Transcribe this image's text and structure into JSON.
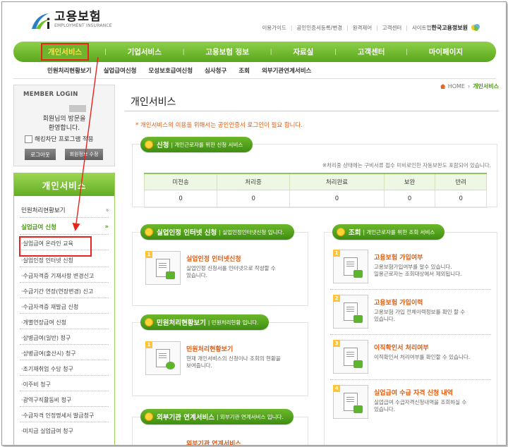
{
  "header": {
    "logo_ko": "고용보험",
    "logo_en": "EMPLOYMENT INSURANCE",
    "util_links": [
      "이용가이드",
      "공인인증서등록/변경",
      "원격제어",
      "고객센터",
      "사이트맵"
    ],
    "agency": "한국고용정보원"
  },
  "gnb": [
    "개인서비스",
    "기업서비스",
    "고용보험 정보",
    "자료실",
    "고객센터",
    "마이페이지"
  ],
  "subnav": [
    "민원처리현황보기",
    "실업급여신청",
    "모성보호급여신청",
    "심사청구",
    "조회",
    "외부기관연계서비스"
  ],
  "login": {
    "title": "MEMBER LOGIN",
    "greeting1": "회원님의 방문을",
    "greeting2": "환영합니다.",
    "checkbox": "해킹차단 프로그램 적용",
    "logout": "로그아웃",
    "info": "회원정보 수정"
  },
  "lnb": {
    "title": "개인서비스",
    "menu1": "민원처리현황보기",
    "menu1_arrow": "»",
    "menu2": "실업급여 신청",
    "menu2_arrow": "»",
    "sub_items": [
      "·실업급여 온라인 교육",
      "·실업인정 인터넷 신청",
      "·수급자격증 기재사항 변경신고",
      "·수급기간 연장(연장변경) 신고",
      "·수급자격증 재발급 신청",
      "·개별연장급여 신청",
      "·상병급여(일반) 청구",
      "·상병급여(출산시) 청구",
      "·조기재취업 수당 청구",
      "·이주비 청구",
      "·광역구직활동비 청구",
      "·수급자격 인정명세서 발급청구",
      "·미지급 실업급여 청구"
    ]
  },
  "breadcrumb": {
    "home": "HOME",
    "sep": "›",
    "current": "개인서비스"
  },
  "page_title": "개인서비스",
  "notice": "* 개인서비스의 이용을 위해서는 공인인증서 로그인이 필요 합니다.",
  "apply": {
    "title": "신청",
    "desc": "| 개인근로자를 위한 신청 서비스",
    "note": "※처리중 상태에는 구비서류 접수 미비로인한 자동보완도 포함되어 있습니다.",
    "columns": [
      "미전송",
      "처리중",
      "처리완료",
      "보완",
      "반려"
    ],
    "values": [
      "0",
      "0",
      "0",
      "0",
      "0"
    ]
  },
  "sections": {
    "unemp": {
      "title": "실업인정 인터넷 신청",
      "desc": "| 실업인정인터넷신청 입니다."
    },
    "civil": {
      "title": "민원처리현황보기",
      "desc": "| 민원처리현황 입니다."
    },
    "ext": {
      "title": "외부기관 연계서비스",
      "desc": "| 외부기관 연계서비스 입니다."
    },
    "lookup": {
      "title": "조회",
      "desc": "| 개인근로자를 위한 조회 서비스"
    }
  },
  "cards": {
    "unemp": {
      "num": "1",
      "title": "실업인정 인터넷신청",
      "desc1": "실업인정 신청서를 인터넷으로 작성할 수",
      "desc2": "있습니다."
    },
    "civil": {
      "num": "1",
      "title": "민원처리현황보기",
      "desc1": "현재 개인서비스의 신청이나 조회의 현황을",
      "desc2": "보여줍니다."
    },
    "ext": {
      "title": "외부기관 연계서비스"
    },
    "lookup": [
      {
        "num": "1",
        "title": "고용보험 가입여부",
        "desc1": "고용보험가입여부를 알수 있습니다.",
        "desc2": "일용근로자는 조회대상에서 제외됩니다."
      },
      {
        "num": "2",
        "title": "고용보험 가입이력",
        "desc1": "고용보험 가입 전체이력정보를 확인 할 수",
        "desc2": "있습니다."
      },
      {
        "num": "3",
        "title": "이직확인서 처리여부",
        "desc1": "이직확인서 처리여부를 확인할 수 있습니다.",
        "desc2": ""
      },
      {
        "num": "4",
        "title": "실업급여 수급 자격 신청 내역",
        "desc1": "실업급여 수급자격신청내역을 조회하실 수",
        "desc2": "있습니다."
      }
    ]
  },
  "colors": {
    "green": "#5aa71c",
    "orange": "#e05a10",
    "highlight": "#e8221f"
  }
}
